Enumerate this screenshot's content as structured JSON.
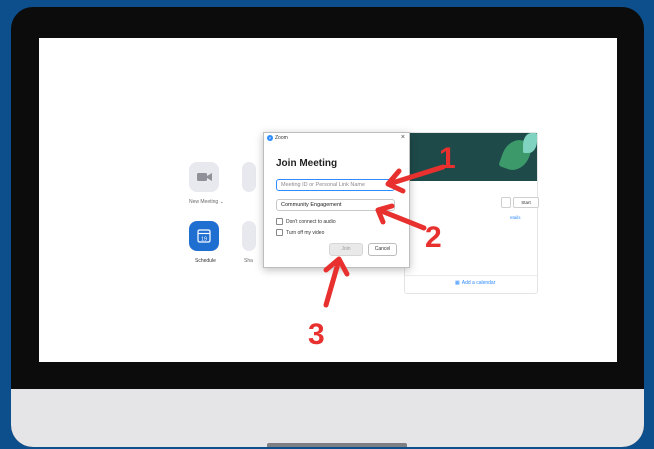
{
  "home": {
    "new_meeting_label": "New Meeting",
    "new_meeting_chevron": "⌄",
    "schedule_label": "Schedule",
    "share_label": "Sha",
    "calendar_day": "19"
  },
  "side_panel": {
    "start_label": "Start",
    "details_label": "etails",
    "add_calendar_label": "Add a calendar"
  },
  "dialog": {
    "window_title": "Zoom",
    "heading": "Join Meeting",
    "meeting_id": {
      "placeholder": "Meeting ID or Personal Link Name",
      "value": ""
    },
    "name_field": {
      "value": "Community Engagement"
    },
    "options": [
      {
        "label": "Don't connect to audio",
        "checked": false
      },
      {
        "label": "Turn off my video",
        "checked": false
      }
    ],
    "join_label": "Join",
    "cancel_label": "Cancel"
  },
  "annotations": [
    "1",
    "2",
    "3"
  ],
  "colors": {
    "background": "#0d4f8c",
    "annotation": "#e8312f",
    "zoom_blue": "#2d8cff",
    "schedule_tile": "#1f6fd1"
  }
}
